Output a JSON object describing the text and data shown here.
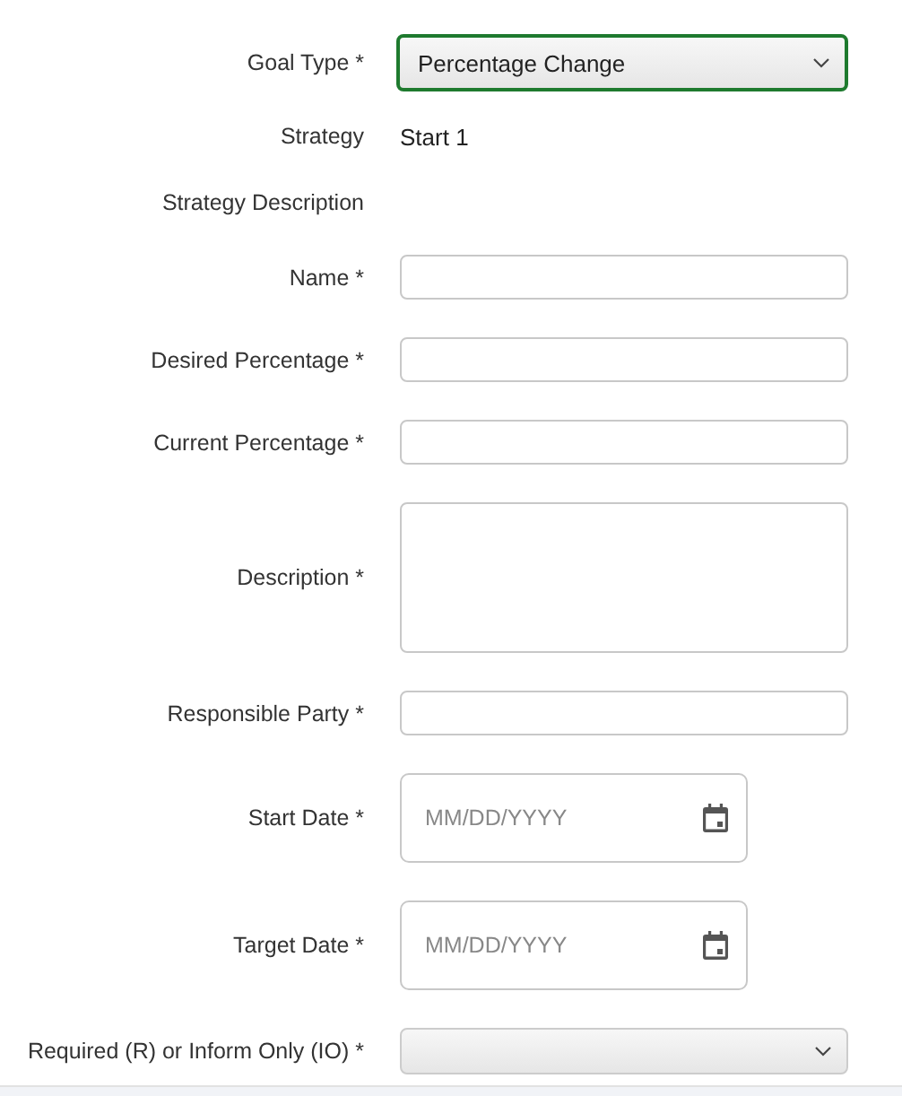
{
  "form": {
    "rows": [
      {
        "kind": "select",
        "label": "Goal Type *",
        "value": "Percentage Change",
        "focused": true
      },
      {
        "kind": "static",
        "label": "Strategy",
        "value": "Start 1"
      },
      {
        "kind": "static",
        "label": "Strategy Description"
      },
      {
        "kind": "text",
        "label": "Name *"
      },
      {
        "kind": "text",
        "label": "Desired Percentage *"
      },
      {
        "kind": "text",
        "label": "Current Percentage *"
      },
      {
        "kind": "textarea",
        "label": "Description *"
      },
      {
        "kind": "text",
        "label": "Responsible Party *"
      },
      {
        "kind": "date",
        "label": "Start Date *",
        "placeholder": "MM/DD/YYYY"
      },
      {
        "kind": "date",
        "label": "Target Date *",
        "placeholder": "MM/DD/YYYY"
      },
      {
        "kind": "select",
        "label": "Required (R) or Inform Only (IO) *",
        "focused": false
      }
    ]
  }
}
